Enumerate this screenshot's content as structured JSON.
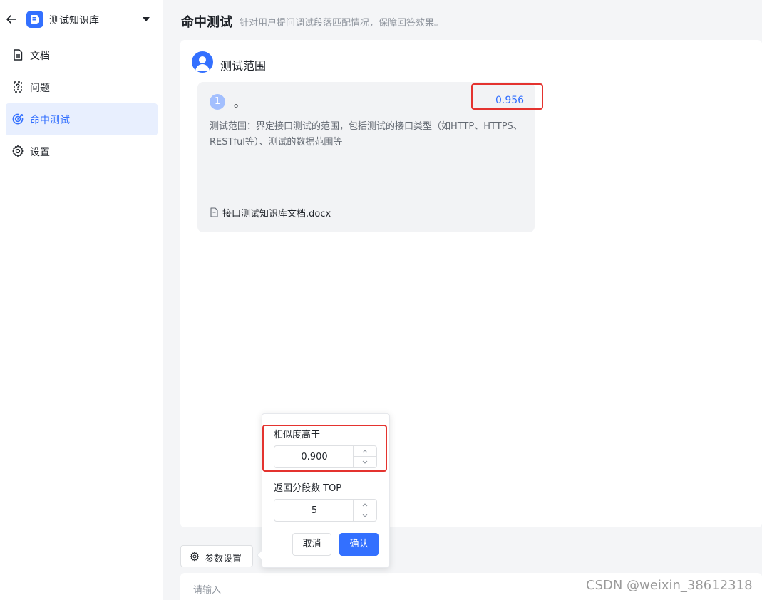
{
  "sidebar": {
    "kb_name": "测试知识库",
    "items": [
      {
        "label": "文档",
        "icon": "document-icon"
      },
      {
        "label": "问题",
        "icon": "question-doc-icon"
      },
      {
        "label": "命中测试",
        "icon": "target-icon",
        "active": true
      },
      {
        "label": "设置",
        "icon": "gear-icon"
      }
    ]
  },
  "header": {
    "title": "命中测试",
    "subtitle": "针对用户提问调试段落匹配情况，保障回答效果。"
  },
  "question": {
    "text": "测试范围"
  },
  "results": [
    {
      "index": "1",
      "title": "。",
      "score": "0.956",
      "content": "测试范围：界定接口测试的范围，包括测试的接口类型（如HTTP、HTTPS、RESTful等）、测试的数据范围等",
      "file": "接口测试知识库文档.docx"
    }
  ],
  "params": {
    "button_label": "参数设置",
    "similarity_label": "相似度高于",
    "similarity_value": "0.900",
    "top_label": "返回分段数 TOP",
    "top_value": "5",
    "cancel_label": "取消",
    "confirm_label": "确认"
  },
  "input": {
    "placeholder": "请输入"
  },
  "watermark": "CSDN @weixin_38612318",
  "colors": {
    "primary": "#3370ff",
    "active_bg": "#e8effe",
    "highlight_box": "#e4332f"
  }
}
